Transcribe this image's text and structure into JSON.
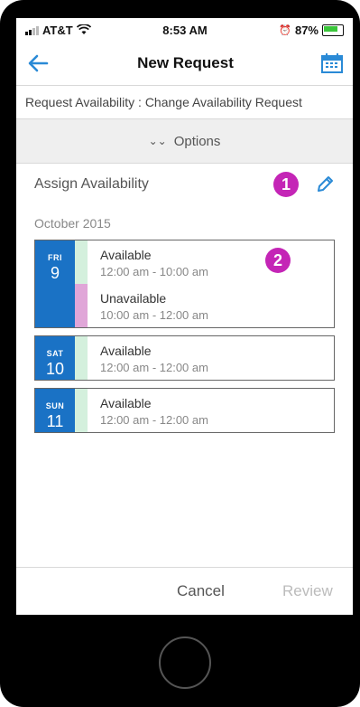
{
  "status": {
    "carrier": "AT&T",
    "time": "8:53 AM",
    "battery": "87%"
  },
  "nav": {
    "title": "New Request"
  },
  "subtitle": "Request Availability : Change Availability Request",
  "options": {
    "label": "Options"
  },
  "assign": {
    "label": "Assign Availability",
    "badge": "1"
  },
  "month": "October 2015",
  "badge2": "2",
  "days": [
    {
      "dow": "FRI",
      "num": "9",
      "entries": [
        {
          "title": "Available",
          "time": "12:00 am - 10:00 am"
        },
        {
          "title": "Unavailable",
          "time": "10:00 am - 12:00 am"
        }
      ]
    },
    {
      "dow": "SAT",
      "num": "10",
      "entries": [
        {
          "title": "Available",
          "time": "12:00 am - 12:00 am"
        }
      ]
    },
    {
      "dow": "SUN",
      "num": "11",
      "entries": [
        {
          "title": "Available",
          "time": "12:00 am - 12:00 am"
        }
      ]
    }
  ],
  "footer": {
    "cancel": "Cancel",
    "review": "Review"
  },
  "colors": {
    "accent": "#1a72c5",
    "available": "#d4f0dd",
    "unavailable": "#e0a6d8",
    "badge": "#c425b6"
  }
}
